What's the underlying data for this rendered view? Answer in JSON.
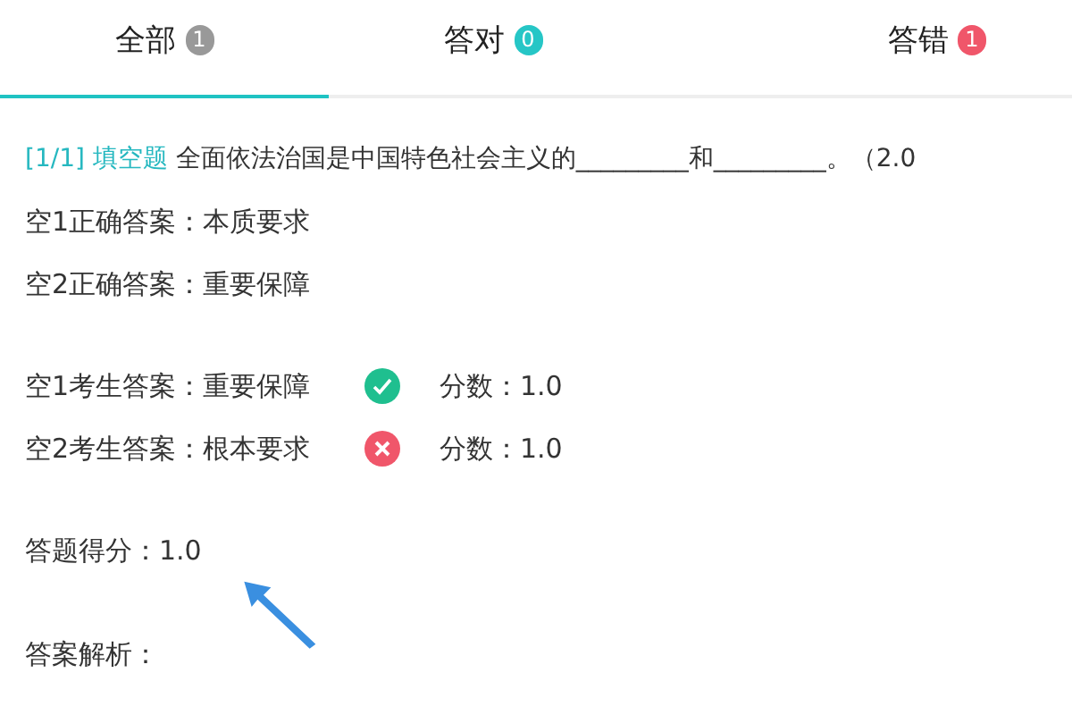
{
  "tabs": [
    {
      "label": "全部",
      "count": "1",
      "kind": "all",
      "selected": true
    },
    {
      "label": "答对",
      "count": "0",
      "kind": "right",
      "selected": false
    },
    {
      "label": "答错",
      "count": "1",
      "kind": "wrong",
      "selected": false
    }
  ],
  "question": {
    "index": "[1/1]",
    "type": "填空题",
    "text": "全面依法治国是中国特色社会主义的_________和_________。（2.0"
  },
  "correct_answers": [
    "空1正确答案：本质要求",
    "空2正确答案：重要保障"
  ],
  "student_answers": [
    {
      "label": "空1考生答案：重要保障",
      "correct": true,
      "score": "分数：1.0"
    },
    {
      "label": "空2考生答案：根本要求",
      "correct": false,
      "score": "分数：1.0"
    }
  ],
  "total_score": "答题得分：1.0",
  "analysis_label": "答案解析："
}
